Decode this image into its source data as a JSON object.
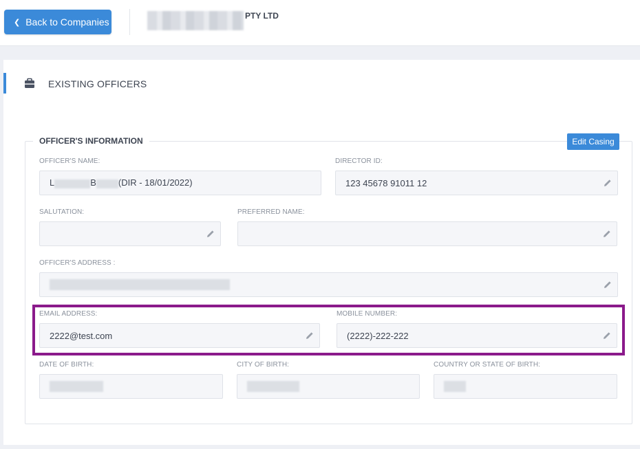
{
  "header": {
    "back_label": "Back to Companies",
    "company_suffix": "PTY LTD"
  },
  "section": {
    "title": "EXISTING OFFICERS"
  },
  "officer_info": {
    "legend": "OFFICER'S INFORMATION",
    "edit_label": "Edit Casing",
    "name_label": "OFFICER'S NAME:",
    "name_prefix": "L",
    "name_mid": "B",
    "name_suffix": "(DIR - 18/01/2022)",
    "director_id_label": "DIRECTOR ID:",
    "director_id_value": "123 45678 91011 12",
    "salutation_label": "SALUTATION:",
    "salutation_value": "",
    "preferred_name_label": "PREFERRED NAME:",
    "preferred_name_value": "",
    "address_label": "OFFICER'S ADDRESS :",
    "email_label": "EMAIL ADDRESS:",
    "email_value": "2222@test.com",
    "mobile_label": "MOBILE NUMBER:",
    "mobile_value": "(2222)-222-222",
    "dob_label": "DATE OF BIRTH:",
    "city_label": "CITY OF BIRTH:",
    "country_label": "COUNTRY OR STATE OF BIRTH:"
  },
  "colors": {
    "accent": "#3b8ad9",
    "highlight": "#8b1a8b"
  },
  "icons": {
    "back": "chevron-left-icon",
    "section": "briefcase-icon",
    "edit_field": "pencil-icon"
  }
}
